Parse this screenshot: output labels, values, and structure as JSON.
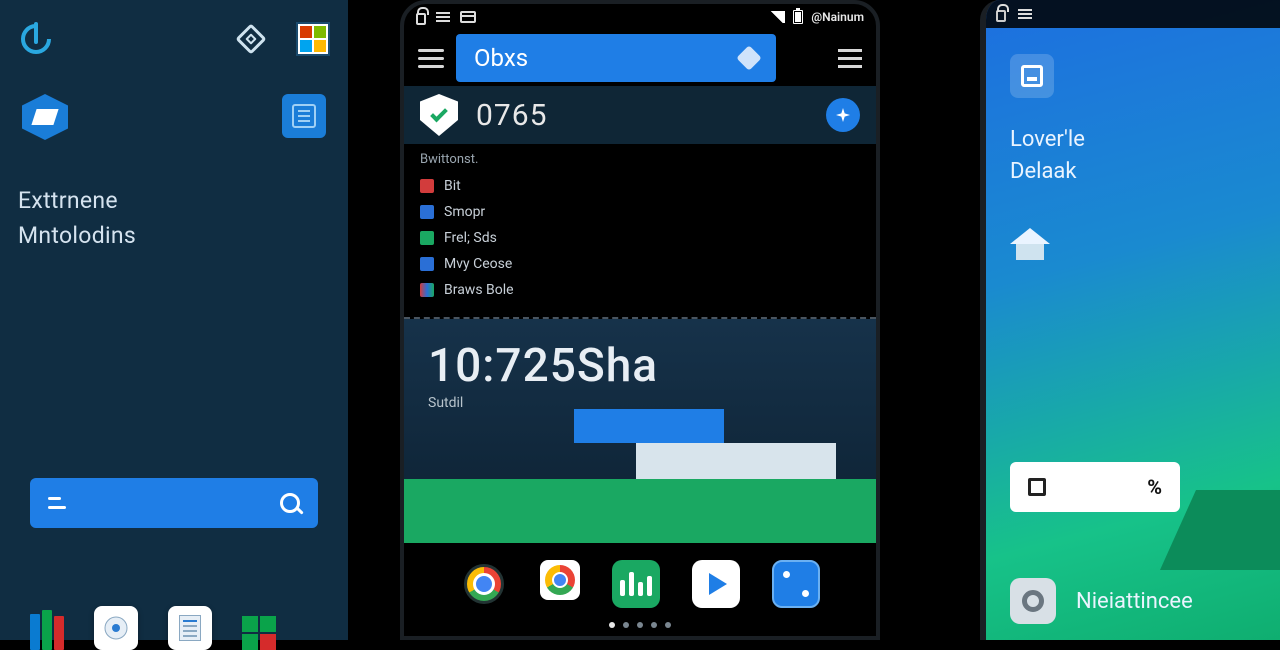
{
  "left": {
    "title_line1": "Exttrnene",
    "title_line2": "Mntolodins"
  },
  "mid": {
    "status_carrier": "@Nainum",
    "title_chip": "Obxs",
    "info_number": "0765",
    "list_header": "Bwittonst.",
    "items": [
      {
        "label": "Bit"
      },
      {
        "label": "Smopr"
      },
      {
        "label": "Frel; Sds"
      },
      {
        "label": "Mvy Ceose"
      },
      {
        "label": "Braws Bole"
      }
    ],
    "clock": "10:725Sha",
    "clock_sub": "Sutdil"
  },
  "right": {
    "text_line1": "Lover'le",
    "text_line2": "Delaak",
    "card_pct": "%",
    "bottom_label": "Nieiattincee"
  }
}
